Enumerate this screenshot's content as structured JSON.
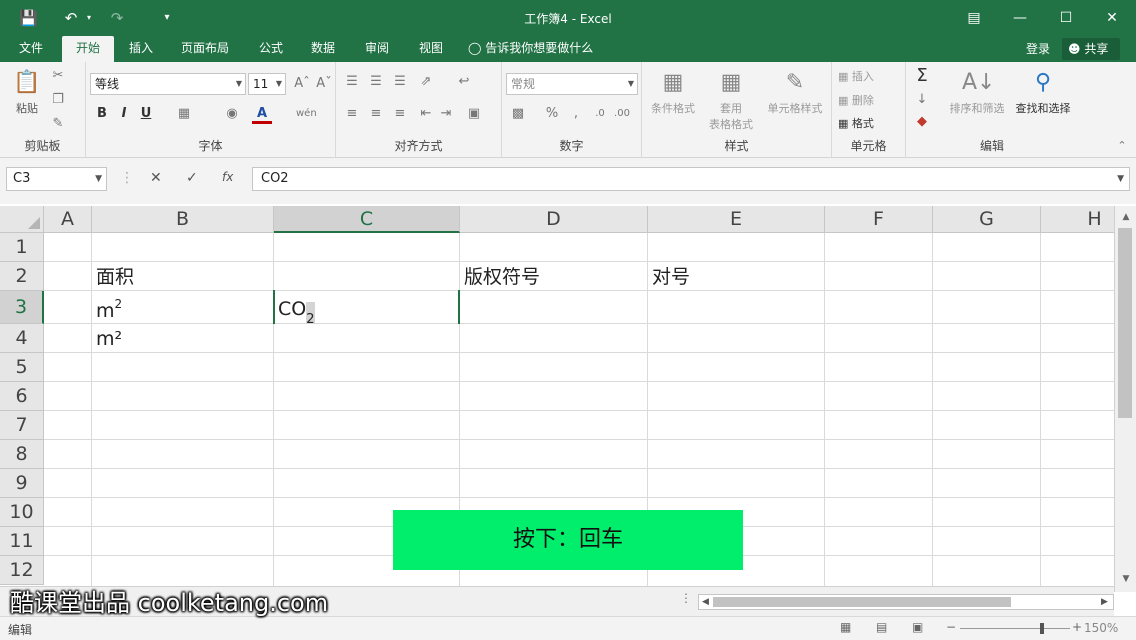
{
  "window": {
    "title": "工作簿4 - Excel",
    "save_icon": "save-icon",
    "undo_icon": "undo-icon",
    "redo_icon": "redo-icon"
  },
  "menu": {
    "tabs": [
      {
        "label": "文件",
        "active": false
      },
      {
        "label": "开始",
        "active": true
      },
      {
        "label": "插入",
        "active": false
      },
      {
        "label": "页面布局",
        "active": false
      },
      {
        "label": "公式",
        "active": false
      },
      {
        "label": "数据",
        "active": false
      },
      {
        "label": "审阅",
        "active": false
      },
      {
        "label": "视图",
        "active": false
      }
    ],
    "tell_me": "告诉我你想要做什么",
    "login": "登录",
    "share": "共享"
  },
  "ribbon": {
    "clipboard": {
      "label": "剪贴板",
      "paste": "粘贴"
    },
    "font": {
      "label": "字体",
      "font_name": "等线",
      "font_size": "11",
      "bold": "B",
      "italic": "I",
      "underline": "U"
    },
    "alignment": {
      "label": "对齐方式"
    },
    "number": {
      "label": "数字",
      "format": "常规"
    },
    "styles": {
      "label": "样式",
      "conditional": "条件格式",
      "table_format_1": "套用",
      "table_format_2": "表格格式",
      "cell_styles": "单元格样式"
    },
    "cells": {
      "label": "单元格",
      "insert": "插入",
      "delete": "删除",
      "format": "格式"
    },
    "editing": {
      "label": "编辑",
      "sort_filter": "排序和筛选",
      "find_select": "查找和选择"
    }
  },
  "formula_bar": {
    "name_box": "C3",
    "formula": "CO2",
    "fx": "fx"
  },
  "columns": [
    "A",
    "B",
    "C",
    "D",
    "E",
    "F",
    "G",
    "H"
  ],
  "rows": [
    "1",
    "2",
    "3",
    "4",
    "5",
    "6",
    "7",
    "8",
    "9",
    "10",
    "11",
    "12"
  ],
  "cells": {
    "B2": "面积",
    "D2": "版权符号",
    "E2": "对号",
    "B3_base": "m",
    "B3_sup": "2",
    "B4": "m²",
    "C3_base": "CO",
    "C3_sub": "2"
  },
  "status": {
    "mode": "编辑",
    "zoom": "150%"
  },
  "overlay": {
    "key_hint": "按下：回车",
    "watermark": "酷课堂出品 coolketang.com"
  }
}
